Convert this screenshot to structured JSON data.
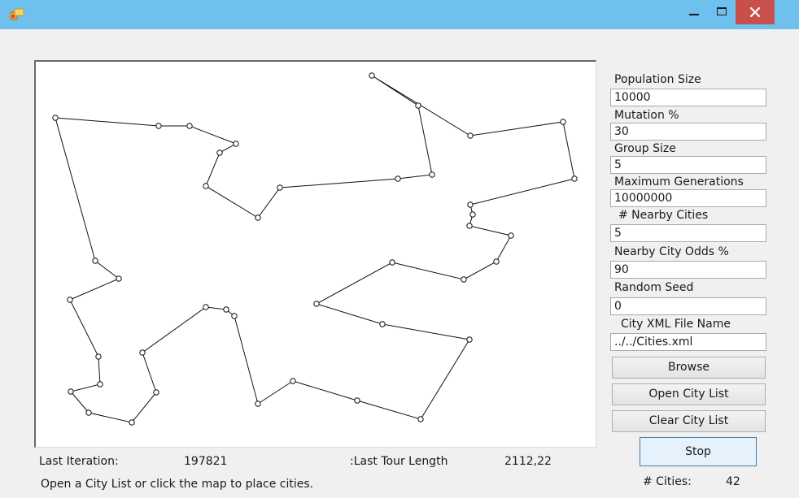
{
  "window": {
    "icon": "app-icon",
    "minimize_icon": "minimize-icon",
    "maximize_icon": "maximize-icon",
    "close_icon": "close-icon",
    "close_color": "#c7504b",
    "titlebar_color": "#6ec1ee"
  },
  "settings": {
    "population_size_label": "Population Size",
    "population_size_value": "10000",
    "mutation_label": "Mutation %",
    "mutation_value": "30",
    "group_size_label": "Group Size",
    "group_size_value": "5",
    "max_generations_label": "Maximum Generations",
    "max_generations_value": "10000000",
    "nearby_cities_label": "# Nearby Cities",
    "nearby_cities_value": "5",
    "nearby_city_odds_label": "Nearby City Odds %",
    "nearby_city_odds_value": "90",
    "random_seed_label": "Random Seed",
    "random_seed_value": "0",
    "city_xml_label": "City XML File Name",
    "city_xml_value": "../../Cities.xml"
  },
  "buttons": {
    "browse": "Browse",
    "open_city_list": "Open City List",
    "clear_city_list": "Clear City List",
    "stop": "Stop"
  },
  "stats": {
    "last_iteration_label": "Last Iteration:",
    "last_iteration_value": "197821",
    "last_tour_length_label": ":Last Tour Length",
    "last_tour_length_value": "2112,22",
    "cities_label": "# Cities:",
    "cities_value": "42"
  },
  "status_message": "Open a City List or click the map to place cities."
}
